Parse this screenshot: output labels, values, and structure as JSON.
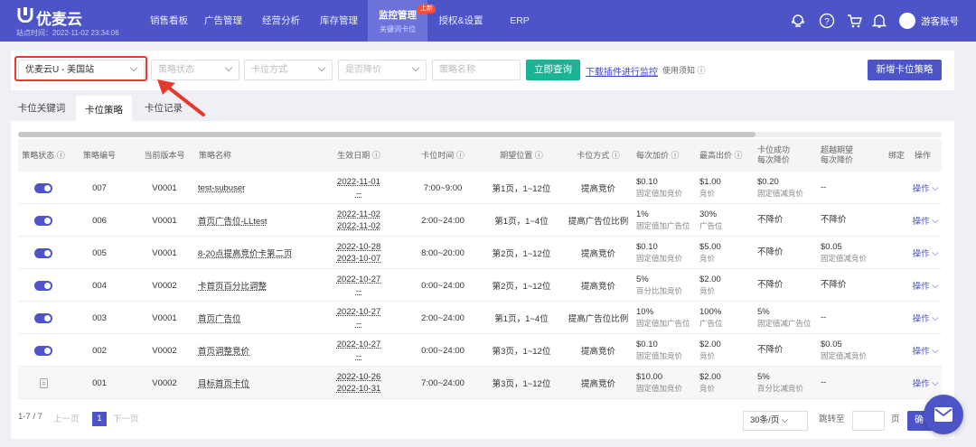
{
  "header": {
    "logo": "优麦云",
    "site_time": "站点时间：2022-11-02 23:34:06",
    "nav": [
      "销售看板",
      "广告管理",
      "经营分析",
      "库存管理"
    ],
    "active_nav": {
      "title": "监控管理",
      "subtitle": "关键词卡位",
      "badge": "上新"
    },
    "nav_right": [
      "授权&设置",
      "ERP"
    ],
    "icons": [
      "support-icon",
      "help-icon",
      "cart-icon",
      "bell-icon"
    ],
    "user": "游客账号"
  },
  "filters": {
    "store": "优麦云U - 美国站",
    "status": "策略状态",
    "method": "卡位方式",
    "lower_price": "是否降价",
    "name_placeholder": "策略名称",
    "query_btn": "立即查询",
    "download_link": "下载插件进行监控",
    "notice": "使用须知",
    "new_btn": "新增卡位策略"
  },
  "tabs": [
    "卡位关键词",
    "卡位策略",
    "卡位记录"
  ],
  "active_tab": "卡位策略",
  "table": {
    "headers": [
      "策略状态",
      "策略编号",
      "当前版本号",
      "策略名称",
      "生效日期",
      "卡位时间",
      "期望位置",
      "卡位方式",
      "每次加价",
      "最高出价",
      "卡位成功\n每次降价",
      "超越期望\n每次降价",
      "绑定",
      "操作"
    ],
    "rows": [
      {
        "status": "on",
        "id": "007",
        "ver": "V0001",
        "name": "test-subuser",
        "date1": "2022-11-01",
        "date2": "--",
        "time": "7:00~9:00",
        "pos": "第1页，1~12位",
        "method": "提高竞价",
        "add": "$0.10",
        "add_sub": "固定值加竞价",
        "max": "$1.00",
        "max_sub": "竞价",
        "succ": "$0.20",
        "succ_sub": "固定值减竞价",
        "exceed": "--",
        "exceed_sub": "",
        "op": "操作"
      },
      {
        "status": "on",
        "id": "006",
        "ver": "V0001",
        "name": "首页广告位-LLtest",
        "date1": "2022-11-02",
        "date2": "2022-11-02",
        "time": "2:00~24:00",
        "pos": "第1页，1~4位",
        "method": "提高广告位比例",
        "add": "1%",
        "add_sub": "固定值加广告位",
        "max": "30%",
        "max_sub": "广告位",
        "succ": "不降价",
        "succ_sub": "",
        "exceed": "不降价",
        "exceed_sub": "",
        "op": "操作"
      },
      {
        "status": "on",
        "id": "005",
        "ver": "V0001",
        "name": "8-20点提高竞价卡第二页",
        "date1": "2022-10-28",
        "date2": "2023-10-07",
        "time": "8:00~20:00",
        "pos": "第2页，1~12位",
        "method": "提高竞价",
        "add": "$0.10",
        "add_sub": "固定值加竞价",
        "max": "$5.00",
        "max_sub": "竞价",
        "succ": "不降价",
        "succ_sub": "",
        "exceed": "$0.05",
        "exceed_sub": "固定值减竞价",
        "op": "操作"
      },
      {
        "status": "on",
        "id": "004",
        "ver": "V0002",
        "name": "卡首页百分比调整",
        "date1": "2022-10-27",
        "date2": "--",
        "time": "0:00~24:00",
        "pos": "第2页，1~12位",
        "method": "提高竞价",
        "add": "5%",
        "add_sub": "百分比加竞价",
        "max": "$2.00",
        "max_sub": "竞价",
        "succ": "不降价",
        "succ_sub": "",
        "exceed": "不降价",
        "exceed_sub": "",
        "op": "操作"
      },
      {
        "status": "on",
        "id": "003",
        "ver": "V0001",
        "name": "首页广告位",
        "date1": "2022-10-27",
        "date2": "--",
        "time": "2:00~24:00",
        "pos": "第1页，1~4位",
        "method": "提高广告位比例",
        "add": "10%",
        "add_sub": "固定值加广告位",
        "max": "100%",
        "max_sub": "广告位",
        "succ": "5%",
        "succ_sub": "固定值减广告位",
        "exceed": "--",
        "exceed_sub": "",
        "op": "操作"
      },
      {
        "status": "on",
        "id": "002",
        "ver": "V0002",
        "name": "首页调整竞价",
        "date1": "2022-10-27",
        "date2": "--",
        "time": "0:00~24:00",
        "pos": "第3页，1~12位",
        "method": "提高竞价",
        "add": "$0.10",
        "add_sub": "固定值加竞价",
        "max": "$2.00",
        "max_sub": "竞价",
        "succ": "不降价",
        "succ_sub": "",
        "exceed": "$0.05",
        "exceed_sub": "固定值减竞价",
        "op": "操作"
      },
      {
        "status": "doc",
        "id": "001",
        "ver": "V0002",
        "name": "目标首页卡位",
        "date1": "2022-10-26",
        "date2": "2022-10-31",
        "time": "7:00~24:00",
        "pos": "第3页，1~12位",
        "method": "提高竞价",
        "add": "$10.00",
        "add_sub": "固定值加竞价",
        "max": "$2.00",
        "max_sub": "竞价",
        "succ": "5%",
        "succ_sub": "百分比减竞价",
        "exceed": "--",
        "exceed_sub": "",
        "op": "操作"
      }
    ]
  },
  "pagination": {
    "range": "1-7 / 7",
    "prev": "上一页",
    "current": "1",
    "next": "下一页",
    "page_size": "30条/页",
    "jump_label": "跳转至",
    "page_unit": "页",
    "confirm": "确"
  },
  "colors": {
    "brand": "#4c54c8",
    "highlight": "#e8392f",
    "query": "#1ab394"
  }
}
